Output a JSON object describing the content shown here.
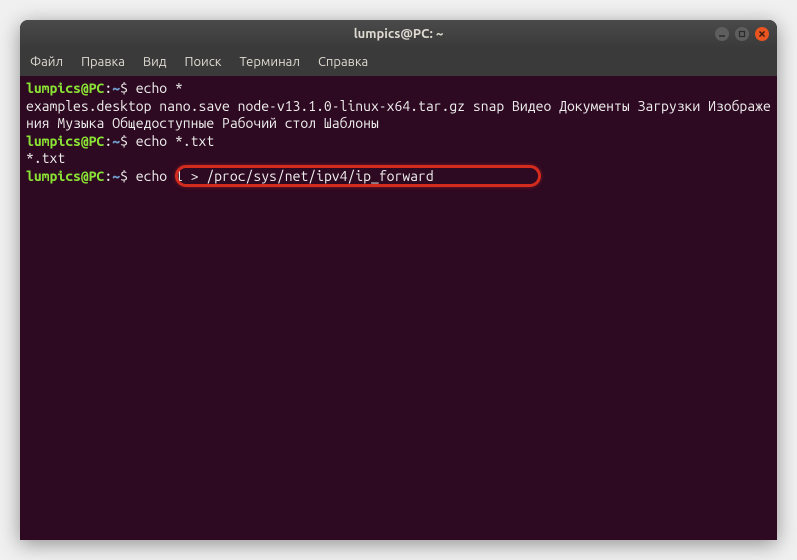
{
  "window": {
    "title": "lumpics@PC: ~"
  },
  "menubar": {
    "items": [
      "Файл",
      "Правка",
      "Вид",
      "Поиск",
      "Терминал",
      "Справка"
    ]
  },
  "terminal": {
    "prompt": {
      "user_host": "lumpics@PC",
      "separator": ":",
      "path": "~",
      "symbol": "$"
    },
    "lines": [
      {
        "type": "prompt",
        "command": "echo *"
      },
      {
        "type": "output",
        "text": "examples.desktop nano.save node-v13.1.0-linux-x64.tar.gz snap Видео Документы Загрузки Изображения Музыка Общедоступные Рабочий стол Шаблоны"
      },
      {
        "type": "prompt",
        "command": "echo *.txt"
      },
      {
        "type": "output",
        "text": "*.txt"
      },
      {
        "type": "prompt",
        "command": "echo 1 > /proc/sys/net/ipv4/ip_forward",
        "highlighted": true
      }
    ]
  },
  "window_controls": {
    "minimize": "minimize",
    "maximize": "maximize",
    "close": "close"
  }
}
